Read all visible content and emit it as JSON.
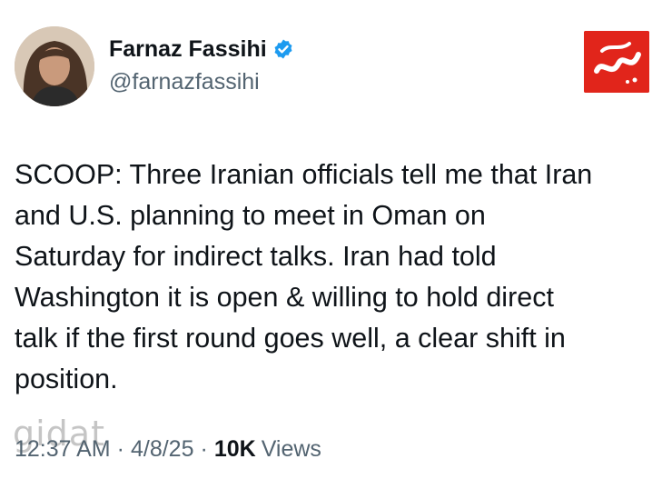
{
  "tweet": {
    "author": {
      "display_name": "Farnaz Fassihi",
      "handle": "@farnazfassihi",
      "verified_icon": "verified-badge-icon",
      "verified_color": "#1d9bf0"
    },
    "text": "SCOOP: Three Iranian officials tell me that Iran\nand U.S. planning to meet in Oman on\nSaturday for indirect talks. Iran had told\nWashington it is open & willing to hold direct\ntalk if the first round goes well, a clear shift in\nposition.",
    "time": "12:37 AM",
    "date": "4/8/25",
    "separator": "·",
    "views_count": "10K",
    "views_label": "Views"
  },
  "branding": {
    "logo_name": "mihan-logo",
    "logo_color": "#e1251b",
    "watermark_text": "gidat"
  }
}
